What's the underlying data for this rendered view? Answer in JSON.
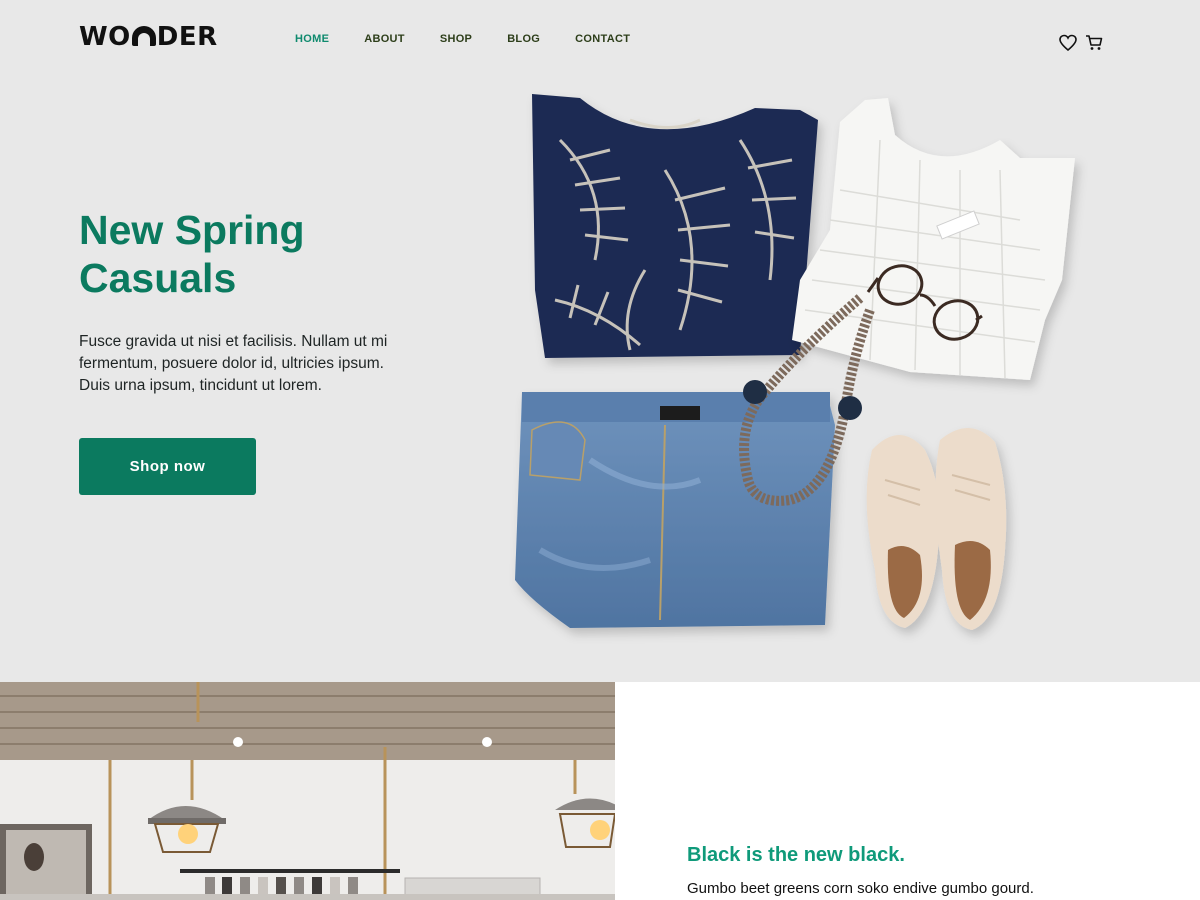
{
  "brand": {
    "logo": "WONDER"
  },
  "nav": {
    "items": [
      {
        "label": "HOME",
        "active": true
      },
      {
        "label": "ABOUT",
        "active": false
      },
      {
        "label": "SHOP",
        "active": false
      },
      {
        "label": "BLOG",
        "active": false
      },
      {
        "label": "CONTACT",
        "active": false
      }
    ]
  },
  "header_icons": [
    "heart-icon",
    "cart-icon"
  ],
  "hero": {
    "title_line1": "New Spring",
    "title_line2": "Casuals",
    "text": "Fusce gravida ut nisi et facilisis. Nullam ut mi fermentum, posuere dolor id, ultricies ipsum. Duis urna ipsum, tincidunt ut lorem.",
    "cta_label": "Shop now",
    "image_alt": "flat-lay outfit: printed top, knit tank, glasses, necklace, denim jeans, brogue shoes"
  },
  "feature": {
    "heading": "Black is the new black.",
    "text": "Gumbo beet greens corn soko endive gumbo gourd."
  },
  "colors": {
    "brand_green": "#0b7a5f",
    "accent_green": "#0f9a7a",
    "page_bg": "#e8e8e8"
  }
}
